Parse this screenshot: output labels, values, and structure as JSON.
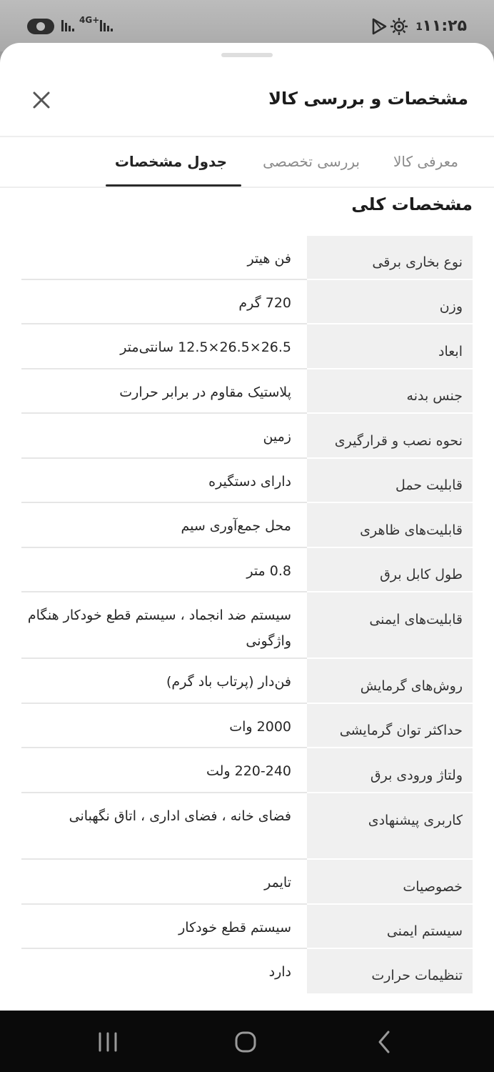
{
  "status_bar": {
    "network": "4G+",
    "notification_count": "1",
    "time": "۱۱:۲۵"
  },
  "sheet": {
    "title": "مشخصات و بررسی کالا"
  },
  "tabs": [
    {
      "label": "معرفی کالا",
      "active": false
    },
    {
      "label": "بررسی تخصصی",
      "active": false
    },
    {
      "label": "جدول مشخصات",
      "active": true
    }
  ],
  "section": {
    "title": "مشخصات کلی"
  },
  "specs": [
    {
      "label": "نوع بخاری برقی",
      "value": "فن هیتر"
    },
    {
      "label": "وزن",
      "value": "720 گرم"
    },
    {
      "label": "ابعاد",
      "value": "26.5×26.5×12.5   سانتی‌متر"
    },
    {
      "label": "جنس بدنه",
      "value": "پلاستیک مقاوم در برابر حرارت"
    },
    {
      "label": "نحوه نصب و قرارگیری",
      "value": "زمین"
    },
    {
      "label": "قابلیت حمل",
      "value": "دارای دستگیره"
    },
    {
      "label": "قابلیت‌های ظاهری",
      "value": "محل جمع‌آوری سیم"
    },
    {
      "label": "طول کابل برق",
      "value": "0.8 متر"
    },
    {
      "label": "قابلیت‌های ایمنی",
      "value": "سیستم ضد انجماد ، سیستم قطع خودکار هنگام واژگونی"
    },
    {
      "label": "روش‌های گرمایش",
      "value": "فن‌دار (پرتاب باد گرم)"
    },
    {
      "label": "حداکثر توان گرمایشی",
      "value": "2000 وات"
    },
    {
      "label": "ولتاژ ورودی برق",
      "value": "220-240 ولت"
    },
    {
      "label": "کاربری پیشنهادی",
      "value": "فضای خانه ، فضای اداری ، اتاق نگهبانی"
    },
    {
      "label": "خصوصیات",
      "value": "تایمر"
    },
    {
      "label": "سیستم ایمنی",
      "value": "سیستم قطع خودکار"
    },
    {
      "label": "تنظیمات حرارت",
      "value": "دارد"
    }
  ],
  "icons": {
    "close": "close-icon",
    "recents": "recents-icon",
    "home": "home-icon",
    "back": "back-icon"
  }
}
